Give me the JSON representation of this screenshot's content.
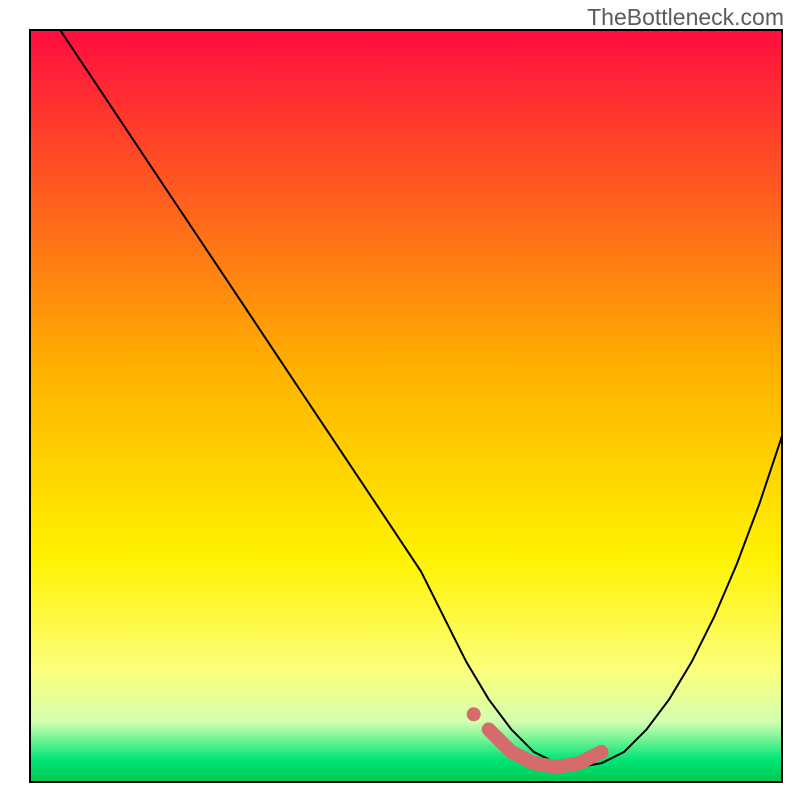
{
  "watermark": "TheBottleneck.com",
  "chart_data": {
    "type": "line",
    "title": "",
    "xlabel": "",
    "ylabel": "",
    "xlim": [
      0,
      100
    ],
    "ylim": [
      0,
      100
    ],
    "series": [
      {
        "name": "curve",
        "x": [
          4,
          8,
          12,
          16,
          20,
          24,
          28,
          32,
          36,
          40,
          44,
          48,
          52,
          55,
          58,
          61,
          64,
          67,
          70,
          73,
          76,
          79,
          82,
          85,
          88,
          91,
          94,
          97,
          100
        ],
        "y": [
          100,
          94,
          88,
          82,
          76,
          70,
          64,
          58,
          52,
          46,
          40,
          34,
          28,
          22,
          16,
          11,
          7,
          4,
          2.5,
          2,
          2.5,
          4,
          7,
          11,
          16,
          22,
          29,
          37,
          46
        ]
      },
      {
        "name": "optimal-range-marker",
        "x": [
          61,
          64,
          67,
          70,
          73,
          76
        ],
        "y": [
          7,
          4,
          2.5,
          2,
          2.5,
          4
        ]
      }
    ],
    "gradient_stops": [
      {
        "offset": 0,
        "color": "#ff0d3e"
      },
      {
        "offset": 45,
        "color": "#ffb100"
      },
      {
        "offset": 70,
        "color": "#fff200"
      },
      {
        "offset": 85,
        "color": "#fcff7a"
      },
      {
        "offset": 92,
        "color": "#d4ffb0"
      },
      {
        "offset": 97,
        "color": "#00e676"
      },
      {
        "offset": 100,
        "color": "#00c853"
      }
    ],
    "border_color": "#000000",
    "marker_color": "#d56b6b"
  }
}
